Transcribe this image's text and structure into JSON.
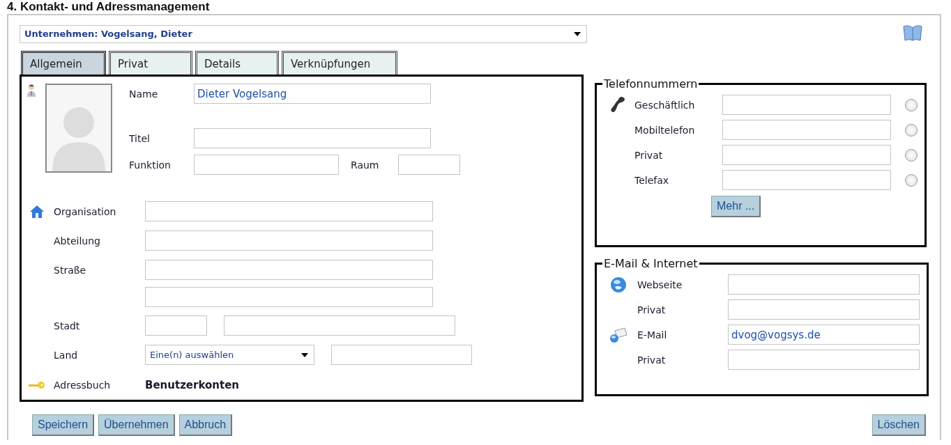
{
  "page_title": "4. Kontakt- und Adressmanagement",
  "company_select": {
    "value": "Unternehmen: Vogelsang, Dieter"
  },
  "tabs": [
    {
      "label": "Allgemein",
      "selected": true
    },
    {
      "label": "Privat",
      "selected": false
    },
    {
      "label": "Details",
      "selected": false
    },
    {
      "label": "Verknüpfungen",
      "selected": false
    }
  ],
  "general": {
    "name": {
      "label": "Name",
      "value": "Dieter Vogelsang"
    },
    "title": {
      "label": "Titel"
    },
    "function": {
      "label": "Funktion"
    },
    "room": {
      "label": "Raum"
    },
    "organisation": {
      "label": "Organisation"
    },
    "department": {
      "label": "Abteilung"
    },
    "street": {
      "label": "Straße"
    },
    "city": {
      "label": "Stadt"
    },
    "country": {
      "label": "Land",
      "select_value": "Eine(n) auswählen"
    },
    "address_book": {
      "label": "Adressbuch",
      "value": "Benutzerkonten"
    }
  },
  "phone_numbers": {
    "legend": "Telefonnummern",
    "rows": [
      {
        "label": "Geschäftlich",
        "selected": false
      },
      {
        "label": "Mobiltelefon",
        "selected": false
      },
      {
        "label": "Privat",
        "selected": false
      },
      {
        "label": "Telefax",
        "selected": false
      }
    ],
    "more_button": "Mehr ..."
  },
  "email_internet": {
    "legend": "E-Mail & Internet",
    "rows": [
      {
        "label": "Webseite"
      },
      {
        "label": "Privat"
      },
      {
        "label": "E-Mail",
        "value": "dvog@vogsys.de"
      },
      {
        "label": "Privat"
      }
    ]
  },
  "buttons": [
    "Speichern",
    "Übernehmen",
    "Abbruch"
  ],
  "delete_button": "Löschen"
}
